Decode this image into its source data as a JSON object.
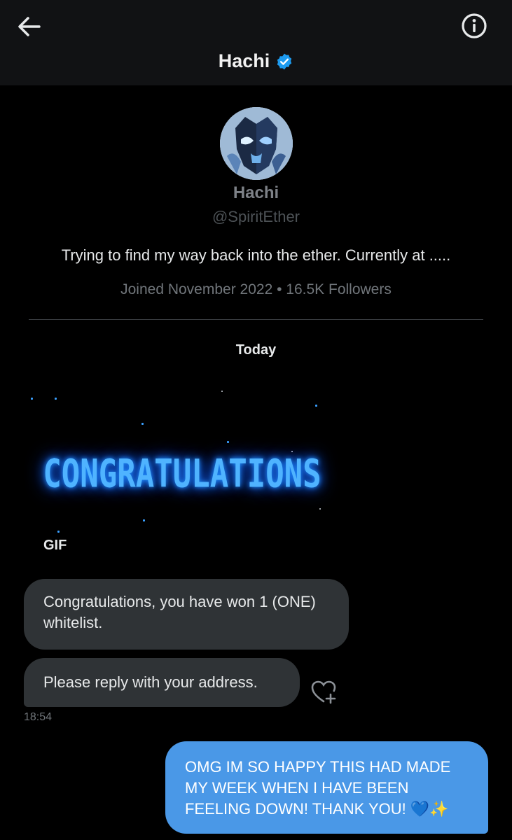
{
  "header": {
    "title": "Hachi",
    "back_icon": "arrow-left-icon",
    "info_icon": "info-icon",
    "verified_icon": "verified-badge-icon"
  },
  "profile": {
    "name": "Hachi",
    "handle": "@SpiritEther",
    "bio": "Trying to find my way back into the ether. Currently at .....",
    "meta": "Joined November 2022 • 16.5K Followers"
  },
  "conversation": {
    "date_separator": "Today",
    "gif": {
      "text": "CONGRATULATIONS",
      "label": "GIF"
    },
    "messages": [
      {
        "direction": "incoming",
        "text": "Congratulations, you have won 1 (ONE) whitelist."
      },
      {
        "direction": "incoming",
        "text": "Please reply with your address.",
        "time": "18:54"
      },
      {
        "direction": "outgoing",
        "text": "OMG IM SO HAPPY THIS HAD MADE MY WEEK WHEN I HAVE BEEN FEELING DOWN! THANK YOU! 💙✨"
      }
    ],
    "react_icon": "heart-plus-icon"
  },
  "colors": {
    "background": "#000000",
    "header_bg": "#111214",
    "incoming_bubble": "#2f3336",
    "outgoing_bubble": "#4a98e7",
    "verified": "#1d9bf0",
    "gif_glow": "#4fb3ff"
  }
}
